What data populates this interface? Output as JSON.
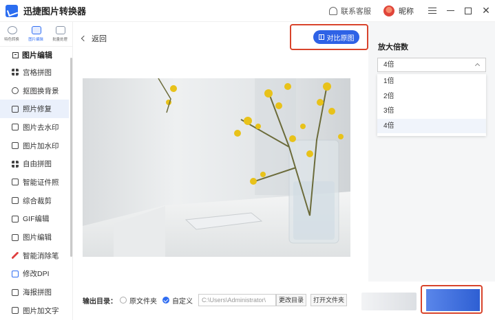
{
  "app": {
    "title": "迅捷图片转换器",
    "contact_label": "联系客服",
    "nickname": "昵称"
  },
  "rail": {
    "tabs": [
      {
        "label": "特色转换",
        "icon": "swap-icon"
      },
      {
        "label": "图片编辑",
        "icon": "image-edit-icon"
      },
      {
        "label": "批量处理",
        "icon": "batch-icon"
      }
    ],
    "section_title": "图片编辑",
    "items": [
      {
        "label": "宫格拼图",
        "icon": "grid-icon"
      },
      {
        "label": "抠图换背景",
        "icon": "cutout-icon"
      },
      {
        "label": "照片修复",
        "icon": "repair-icon"
      },
      {
        "label": "图片去水印",
        "icon": "remove-watermark-icon"
      },
      {
        "label": "图片加水印",
        "icon": "add-watermark-icon"
      },
      {
        "label": "自由拼图",
        "icon": "collage-icon"
      },
      {
        "label": "智能证件照",
        "icon": "id-photo-icon"
      },
      {
        "label": "综合裁剪",
        "icon": "crop-icon"
      },
      {
        "label": "GIF编辑",
        "icon": "gif-icon"
      },
      {
        "label": "图片编辑",
        "icon": "edit-icon"
      },
      {
        "label": "智能消除笔",
        "icon": "eraser-pen-icon"
      },
      {
        "label": "修改DPI",
        "icon": "dpi-icon"
      },
      {
        "label": "海报拼图",
        "icon": "poster-icon"
      },
      {
        "label": "图片加文字",
        "icon": "add-text-icon"
      }
    ],
    "active_item": "照片修复"
  },
  "main": {
    "back_label": "返回",
    "compare_label": "对比原图",
    "output": {
      "label": "输出目录：",
      "option_original": "原文件夹",
      "option_custom": "自定义",
      "path_value": "C:\\Users\\Administrator\\",
      "change_dir_label": "更改目录",
      "open_folder_label": "打开文件夹"
    }
  },
  "right_panel": {
    "title": "放大倍数",
    "selected": "4倍",
    "options": [
      "1倍",
      "2倍",
      "3倍",
      "4倍"
    ]
  },
  "colors": {
    "accent": "#2e62e6",
    "highlight_frame": "#d8432b"
  }
}
